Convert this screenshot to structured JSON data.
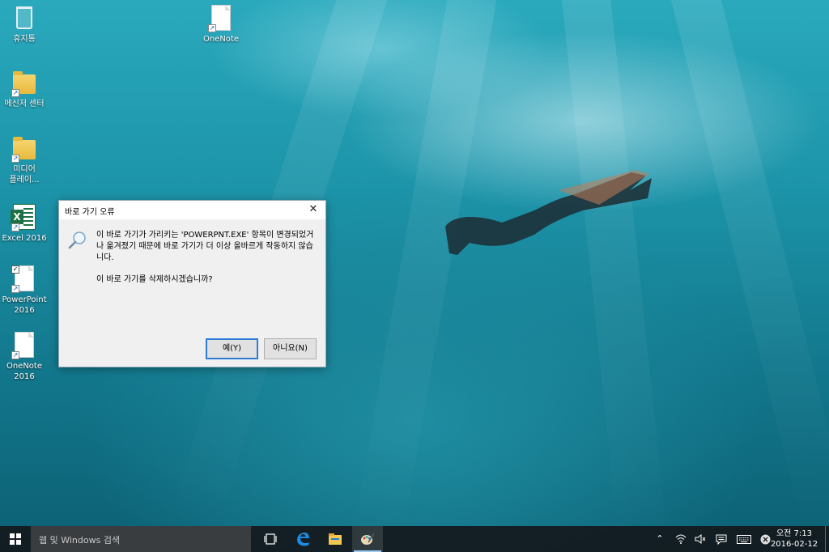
{
  "desktop": {
    "icons": [
      {
        "label": "휴지통",
        "icon": "recycle-bin-icon"
      },
      {
        "label": "OneNote",
        "icon": "onenote-icon"
      },
      {
        "label": "메신저 센터",
        "icon": "folder-icon"
      },
      {
        "label": "미디어\n플레이...",
        "icon": "media-player-icon"
      },
      {
        "label": "Excel 2016",
        "icon": "excel-icon"
      },
      {
        "label": "PowerPoint\n2016",
        "icon": "powerpoint-icon"
      },
      {
        "label": "OneNote\n2016",
        "icon": "onenote-icon"
      }
    ]
  },
  "dialog": {
    "title": "바로 가기 오류",
    "close_glyph": "✕",
    "message": "이 바로 가기가 가리키는 'POWERPNT.EXE' 항목이 변경되었거나 옮겨졌기 때문에 바로 가기가 더 이상 올바르게 작동하지 않습니다.",
    "question": "이 바로 가기를 삭제하시겠습니까?",
    "yes_label": "예(Y)",
    "no_label": "아니요(N)"
  },
  "taskbar": {
    "search_placeholder": "웹 및 Windows 검색",
    "clock_time": "오전 7:13",
    "clock_date": "2016-02-12",
    "apps": [
      "task-view-icon",
      "edge-icon",
      "file-explorer-icon",
      "paint-icon"
    ],
    "tray": [
      "chevron-up-icon",
      "wifi-icon",
      "volume-muted-icon",
      "action-center-icon",
      "keyboard-icon",
      "close-circle-icon"
    ]
  },
  "colors": {
    "accent": "#2f7bd6",
    "taskbar": "#14181c",
    "dialog_bg": "#f0f0f0"
  }
}
